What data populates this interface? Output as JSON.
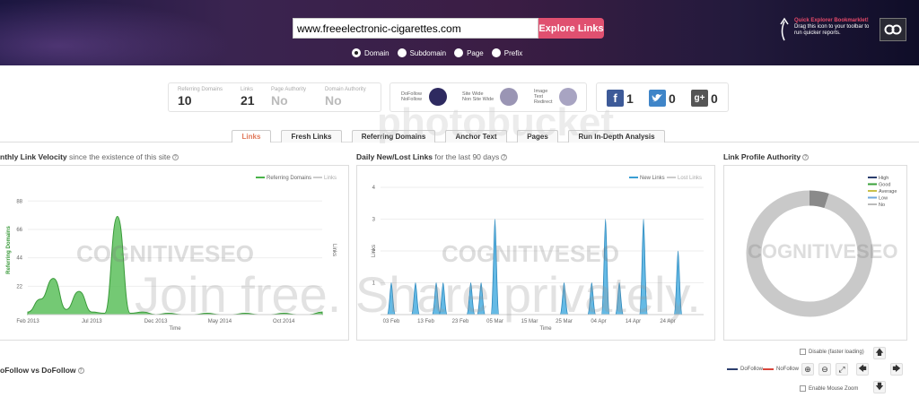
{
  "header": {
    "url_value": "www.freeelectronic-cigarettes.com",
    "explore_label": "Explore Links",
    "bookmarklet_title": "Quick Explorer Bookmarklet!",
    "bookmarklet_line1": "Drag this icon to your toolbar to",
    "bookmarklet_line2": "run quicker reports.",
    "scope_options": [
      "Domain",
      "Subdomain",
      "Page",
      "Prefix"
    ],
    "scope_selected": "Domain"
  },
  "stats": {
    "referring_domains_label": "Referring Domains",
    "referring_domains_value": "10",
    "links_label": "Links",
    "links_value": "21",
    "page_authority_label": "Page Authority",
    "page_authority_value": "No",
    "domain_authority_label": "Domain Authority",
    "domain_authority_value": "No"
  },
  "link_types": {
    "dofollow": "DoFollow",
    "nofollow": "NoFollow",
    "sitewide": "Site Wide",
    "nonsitewide": "Non Site Wide",
    "image": "Image",
    "text": "Text",
    "redirect": "Redirect",
    "colors": {
      "dofollow": "#2e2a60",
      "sitewide": "#9a95b4",
      "image": "#a8a4c2"
    }
  },
  "social": {
    "facebook": "1",
    "twitter": "0",
    "googleplus": "0"
  },
  "tabs": [
    "Links",
    "Fresh Links",
    "Referring Domains",
    "Anchor Text",
    "Pages",
    "Run In-Depth Analysis"
  ],
  "active_tab": "Links",
  "panels": {
    "velocity_title": "nthly Link Velocity",
    "velocity_sub": " since the existence of this site",
    "daily_title": "Daily New/Lost Links",
    "daily_sub": " for the last 90 days",
    "authority_title": "Link Profile Authority",
    "nofollow_title": "oFollow vs DoFollow"
  },
  "watermark": {
    "brand": "COGNITIVESEO",
    "photo": "photobucket",
    "join": "Join free. Share privately."
  },
  "controls": {
    "disable_label": "Disable (faster loading)",
    "mouse_zoom_label": "Enable Mouse Zoom",
    "dofollow_legend": "DoFollow",
    "nofollow_legend": "NoFollow"
  },
  "chart_data": [
    {
      "type": "area",
      "title": "Monthly Link Velocity",
      "xlabel": "Time",
      "ylabel": "Referring Domains",
      "ylabel2": "Links",
      "y_ticks": [
        "22",
        "44",
        "66",
        "88"
      ],
      "x_ticks": [
        "Feb 2013",
        "Jul 2013",
        "Dec 2013",
        "May 2014",
        "Oct 2014"
      ],
      "ylim": [
        0,
        100
      ],
      "legend": [
        "Referring Domains",
        "Links"
      ],
      "series": [
        {
          "name": "Referring Domains",
          "color": "#49b349",
          "x": [
            "Feb 2013",
            "Mar 2013",
            "Apr 2013",
            "May 2013",
            "Jun 2013",
            "Jul 2013",
            "Aug 2013",
            "Sep 2013",
            "Oct 2013",
            "Nov 2013",
            "Dec 2013",
            "Jan 2014",
            "Feb 2014",
            "Mar 2014",
            "Apr 2014",
            "May 2014",
            "Jun 2014",
            "Jul 2014",
            "Aug 2014",
            "Sep 2014",
            "Oct 2014",
            "Nov 2014",
            "Dec 2014",
            "Jan 2015"
          ],
          "values": [
            2,
            12,
            28,
            4,
            18,
            2,
            1,
            76,
            1,
            2,
            0,
            1,
            0,
            0,
            1,
            0,
            0,
            1,
            0,
            0,
            1,
            0,
            0,
            2
          ]
        }
      ]
    },
    {
      "type": "area",
      "title": "Daily New/Lost Links",
      "xlabel": "Time",
      "ylabel": "Links",
      "y_ticks": [
        "1",
        "2",
        "3",
        "4"
      ],
      "x_ticks": [
        "03 Feb",
        "13 Feb",
        "23 Feb",
        "05 Mar",
        "15 Mar",
        "25 Mar",
        "04 Apr",
        "14 Apr",
        "24 Apr"
      ],
      "ylim": [
        0,
        4
      ],
      "legend": [
        "New Links",
        "Lost Links"
      ],
      "series": [
        {
          "name": "New Links",
          "color": "#3a9fd4",
          "spikes": [
            [
              "03 Feb",
              1
            ],
            [
              "10 Feb",
              1
            ],
            [
              "16 Feb",
              1
            ],
            [
              "18 Feb",
              1
            ],
            [
              "26 Feb",
              1
            ],
            [
              "01 Mar",
              1
            ],
            [
              "05 Mar",
              3
            ],
            [
              "25 Mar",
              1
            ],
            [
              "02 Apr",
              1
            ],
            [
              "06 Apr",
              3
            ],
            [
              "10 Apr",
              1
            ],
            [
              "17 Apr",
              3
            ],
            [
              "27 Apr",
              2
            ]
          ]
        }
      ]
    },
    {
      "type": "pie",
      "title": "Link Profile Authority",
      "legend": [
        {
          "name": "High",
          "color": "#2c3e6e"
        },
        {
          "name": "Good",
          "color": "#3aa13a"
        },
        {
          "name": "Average",
          "color": "#c8c04a"
        },
        {
          "name": "Low",
          "color": "#6fa8dc"
        },
        {
          "name": "No",
          "color": "#bbbbbb"
        }
      ],
      "values": [
        {
          "name": "No",
          "value": 95
        },
        {
          "name": "Other",
          "value": 5
        }
      ]
    }
  ]
}
